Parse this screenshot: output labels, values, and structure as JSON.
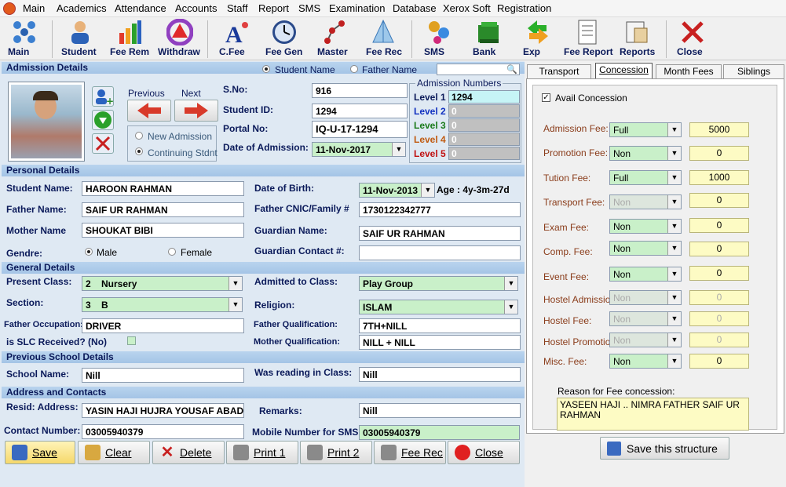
{
  "menu": {
    "items": [
      "Main",
      "Academics",
      "Attendance",
      "Accounts",
      "Staff",
      "Report",
      "SMS",
      "Examination",
      "Database",
      "Xerox Soft",
      "Registration"
    ]
  },
  "toolbar": {
    "buttons": [
      "Main",
      "Student",
      "Fee Rem",
      "Withdraw",
      "C.Fee",
      "Fee Gen",
      "Master",
      "Fee Rec",
      "SMS",
      "Bank",
      "Exp",
      "Fee Report",
      "Reports",
      "Close"
    ]
  },
  "admission": {
    "header": "Admission Details",
    "search_by": {
      "student_name": "Student Name",
      "father_name": "Father Name",
      "selected": "Student Name"
    },
    "previous": "Previous",
    "next": "Next",
    "new_admission": "New Admission",
    "continuing": "Continuing Stdnt",
    "sno_label": "S.No:",
    "sno": "916",
    "student_id_label": "Student ID:",
    "student_id": "1294",
    "portal_label": "Portal No:",
    "portal": "IQ-U-17-1294",
    "date_label": "Date of Admission:",
    "date": "11-Nov-2017",
    "numbers_title": "Admission Numbers",
    "levels": [
      {
        "label": "Level 1",
        "value": "1294",
        "color": "#0b1a5a"
      },
      {
        "label": "Level 2",
        "value": "0",
        "color": "#1030c0"
      },
      {
        "label": "Level 3",
        "value": "0",
        "color": "#1a7a1a"
      },
      {
        "label": "Level 4",
        "value": "0",
        "color": "#c05a10"
      },
      {
        "label": "Level 5",
        "value": "0",
        "color": "#c01010"
      }
    ]
  },
  "personal": {
    "header": "Personal Details",
    "student_name_label": "Student Name:",
    "student_name": "HAROON RAHMAN",
    "father_name_label": "Father Name:",
    "father_name": "SAIF UR RAHMAN",
    "mother_name_label": "Mother Name",
    "mother_name": "SHOUKAT BIBI",
    "gender_label": "Gendre:",
    "male": "Male",
    "female": "Female",
    "dob_label": "Date of Birth:",
    "dob": "11-Nov-2013",
    "age": "Age : 4y-3m-27d",
    "cnic_label": "Father CNIC/Family #",
    "cnic": "1730122342777",
    "guardian_label": "Guardian Name:",
    "guardian": "SAIF UR RAHMAN",
    "guardian_contact_label": "Guardian Contact #:",
    "guardian_contact": ""
  },
  "general": {
    "header": "General Details",
    "class_label": "Present Class:",
    "class": "2    Nursery",
    "section_label": "Section:",
    "section": "3    B",
    "occupation_label": "Father Occupation:",
    "occupation": "DRIVER",
    "slc_label": "is SLC Received? (No)",
    "admitted_label": "Admitted to Class:",
    "admitted": "Play Group",
    "religion_label": "Religion:",
    "religion": "ISLAM",
    "fq_label": "Father Qualification:",
    "fq": "7TH+NILL",
    "mq_label": "Mother Qualification:",
    "mq": "NILL + NILL"
  },
  "previous": {
    "header": "Previous School Details",
    "school_label": "School Name:",
    "school": "Nill",
    "reading_label": "Was reading in  Class:",
    "reading": "Nill"
  },
  "address": {
    "header": "Address and Contacts",
    "resid_label": "Resid: Address:",
    "resid": "YASIN HAJI HUJRA YOUSAF ABAD",
    "contact_label": "Contact Number:",
    "contact": "03005940379",
    "remarks_label": "Remarks:",
    "remarks": "Nill",
    "mobile_label": "Mobile Number for SMS",
    "mobile": "03005940379"
  },
  "actions": [
    "Save",
    "Clear",
    "Delete",
    "Print 1",
    "Print 2",
    "Fee Rec",
    "Close"
  ],
  "tabs": [
    "Transport",
    "Concession",
    "Month Fees",
    "Siblings"
  ],
  "concession": {
    "avail_label": "Avail Concession",
    "fees": [
      {
        "label": "Admission Fee:",
        "type": "Full",
        "amount": "5000",
        "enabled": true
      },
      {
        "label": "Promotion Fee:",
        "type": "Non",
        "amount": "0",
        "enabled": true
      },
      {
        "label": "Tution Fee:",
        "type": "Full",
        "amount": "1000",
        "enabled": true
      },
      {
        "label": "Transport Fee:",
        "type": "Non",
        "amount": "0",
        "enabled": false
      },
      {
        "label": "Exam Fee:",
        "type": "Non",
        "amount": "0",
        "enabled": true
      },
      {
        "label": "Comp. Fee:",
        "type": "Non",
        "amount": "0",
        "enabled": true
      },
      {
        "label": "Event Fee:",
        "type": "Non",
        "amount": "0",
        "enabled": true
      },
      {
        "label": "Hostel Admission",
        "type": "Non",
        "amount": "0",
        "enabled": false
      },
      {
        "label": "Hostel Fee:",
        "type": "Non",
        "amount": "0",
        "enabled": false
      },
      {
        "label": "Hostel Promotion:",
        "type": "Non",
        "amount": "0",
        "enabled": false
      },
      {
        "label": "Misc. Fee:",
        "type": "Non",
        "amount": "0",
        "enabled": true
      }
    ],
    "reason_label": "Reason for Fee concession:",
    "reason": "YASEEN HAJI .. NIMRA FATHER SAIF UR RAHMAN",
    "save_label": "Save this structure"
  }
}
